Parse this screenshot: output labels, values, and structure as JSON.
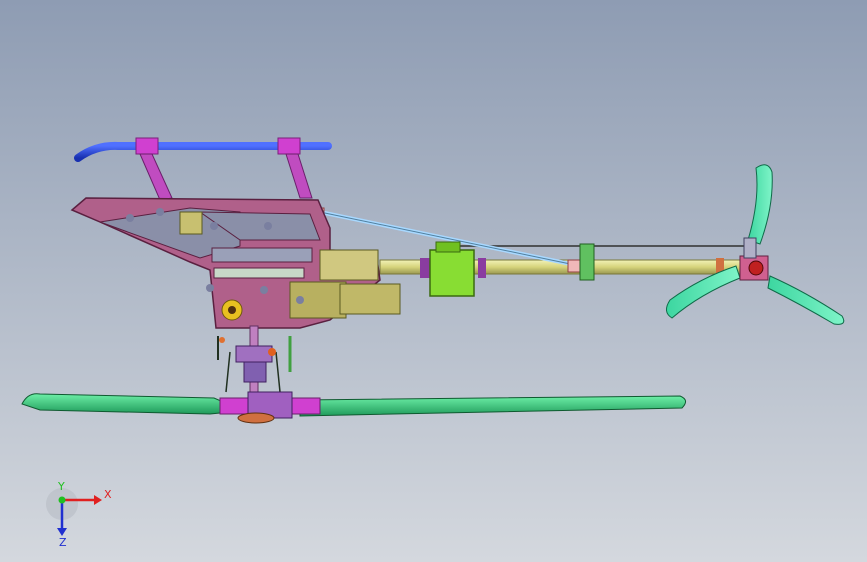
{
  "app": {
    "background_top": "#8e9cb3",
    "background_bottom": "#d4d8de"
  },
  "triad": {
    "x_label": "X",
    "y_label": "Y",
    "z_label": "Z",
    "x_color": "#e02020",
    "y_color": "#20c020",
    "z_color": "#2030d0"
  },
  "model": {
    "frame_color": "#a0507a",
    "tailboom_color": "#d8d88a",
    "blade_color": "#33cc88",
    "canopy_mount_color": "#2340d8",
    "servo_color": "#88dd33",
    "tail_blade_color": "#44e0a8"
  }
}
